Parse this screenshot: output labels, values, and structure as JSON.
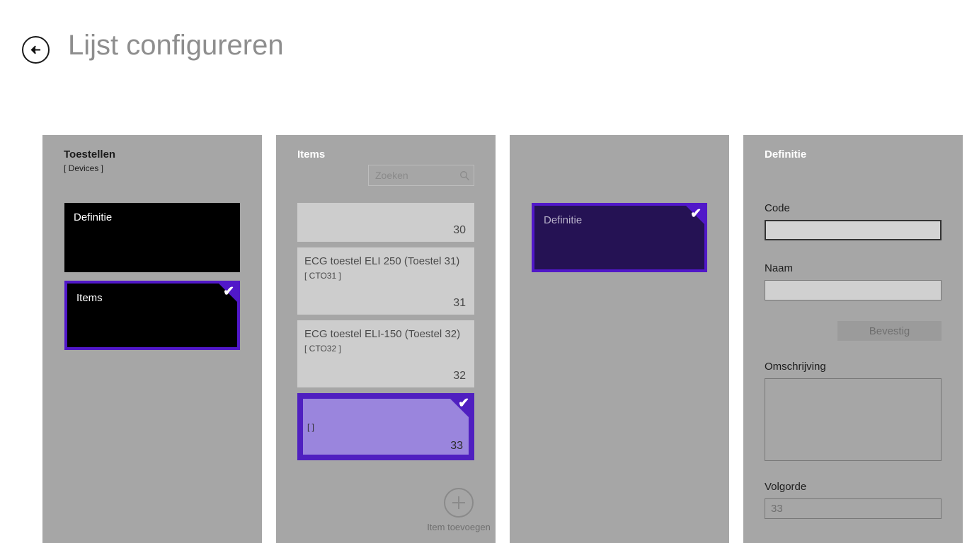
{
  "header": {
    "back_icon": "arrow-left-icon",
    "title": "Lijst configureren"
  },
  "columns": {
    "devices": {
      "title": "Toestellen",
      "subtitle": "[ Devices ]",
      "tiles": [
        {
          "label": "Definitie",
          "selected": false
        },
        {
          "label": "Items",
          "selected": true,
          "check_icon": "check-icon"
        }
      ]
    },
    "items": {
      "title": "Items",
      "search": {
        "placeholder": "Zoeken",
        "value": "",
        "icon": "search-icon"
      },
      "list": [
        {
          "title": "",
          "sub": "",
          "number": "30",
          "selected": false
        },
        {
          "title": "ECG toestel ELI 250 (Toestel 31)",
          "sub": "[ CTO31 ]",
          "number": "31",
          "selected": false
        },
        {
          "title": "ECG toestel ELI-150 (Toestel 32)",
          "sub": "[ CTO32 ]",
          "number": "32",
          "selected": false
        },
        {
          "title": "",
          "sub": "[ ]",
          "number": "33",
          "selected": true,
          "check_icon": "check-icon"
        }
      ],
      "add": {
        "label": "Item toevoegen",
        "icon": "plus-circle-icon"
      }
    },
    "definition_tiles": {
      "title": "",
      "tiles": [
        {
          "label": "Definitie",
          "selected": true,
          "check_icon": "check-icon"
        }
      ]
    },
    "definition_form": {
      "title": "Definitie",
      "fields": {
        "code": {
          "label": "Code",
          "value": "",
          "placeholder": ""
        },
        "naam": {
          "label": "Naam",
          "value": "",
          "placeholder": ""
        },
        "omschrijving": {
          "label": "Omschrijving",
          "value": "",
          "placeholder": ""
        },
        "volgorde": {
          "label": "Volgorde",
          "value": "",
          "placeholder": "33"
        }
      },
      "confirm_label": "Bevestig"
    }
  },
  "colors": {
    "page_background": "#ffffff",
    "panel": "#a6a6a6",
    "accent_purple": "#5118c9",
    "accent_purple_dark": "#251254",
    "accent_purple_light": "#9a85dd",
    "tile_black": "#000000",
    "list_item": "#cdcdcd",
    "title_gray": "#8e8e8e"
  }
}
